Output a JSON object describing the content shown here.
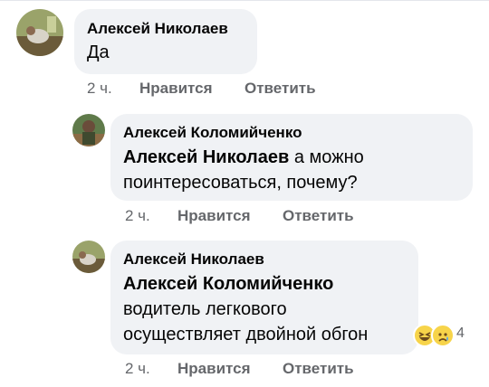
{
  "comments": [
    {
      "author": "Алексей Николаев",
      "mention": "",
      "lines": [
        "Да"
      ],
      "time": "2 ч.",
      "like_label": "Нравится",
      "reply_label": "Ответить"
    },
    {
      "author": "Алексей Коломийченко",
      "mention": "Алексей Николаев",
      "lines": [
        " а можно",
        "поинтересоваться, почему?"
      ],
      "time": "2 ч.",
      "like_label": "Нравится",
      "reply_label": "Ответить"
    },
    {
      "author": "Алексей Николаев",
      "mention": "Алексей Коломийченко",
      "lines": [
        "водитель легкового",
        "осуществляет двойной обгон"
      ],
      "time": "2 ч.",
      "like_label": "Нравится",
      "reply_label": "Ответить",
      "reactions": {
        "icons": [
          "laughing-emoji",
          "sad-emoji"
        ],
        "count": "4"
      }
    }
  ],
  "colors": {
    "bubble": "#f0f2f5",
    "meta_text": "#65676b",
    "text": "#050505"
  }
}
